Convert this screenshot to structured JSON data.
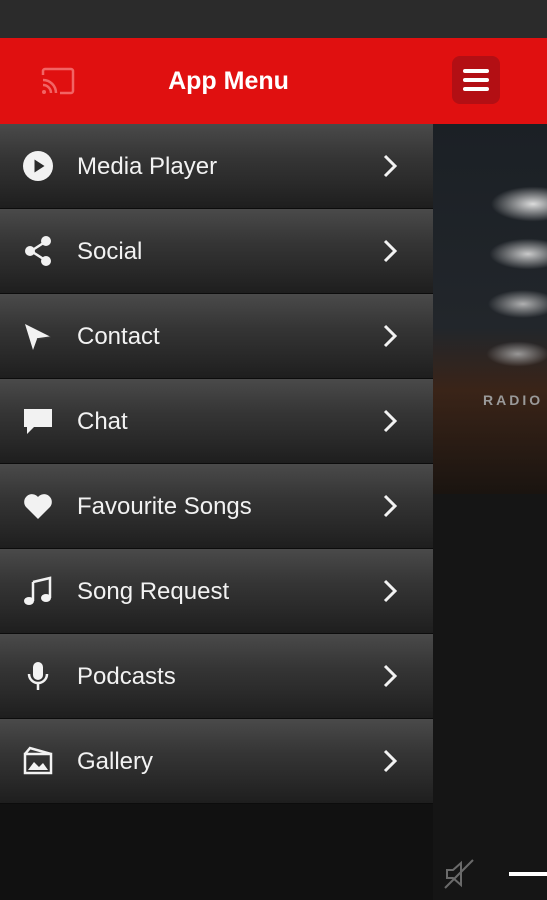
{
  "drawer": {
    "title": "App Menu",
    "items": [
      {
        "label": "Media Player",
        "icon": "play-circle-icon"
      },
      {
        "label": "Social",
        "icon": "share-icon"
      },
      {
        "label": "Contact",
        "icon": "send-icon"
      },
      {
        "label": "Chat",
        "icon": "chat-bubble-icon"
      },
      {
        "label": "Favourite Songs",
        "icon": "heart-icon"
      },
      {
        "label": "Song Request",
        "icon": "music-note-icon"
      },
      {
        "label": "Podcasts",
        "icon": "microphone-icon"
      },
      {
        "label": "Gallery",
        "icon": "gallery-icon"
      }
    ]
  },
  "colors": {
    "header_red": "#e01010",
    "menu_button_red": "#b30f14"
  }
}
